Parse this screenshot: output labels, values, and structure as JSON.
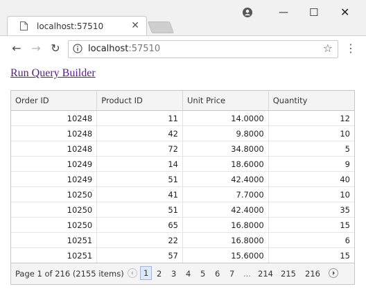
{
  "browser": {
    "tab_title": "localhost:57510",
    "url_host": "localhost",
    "url_port": ":57510"
  },
  "page": {
    "link_text": "Run Query Builder"
  },
  "grid": {
    "columns": [
      "Order ID",
      "Product ID",
      "Unit Price",
      "Quantity"
    ],
    "rows": [
      [
        "10248",
        "11",
        "14.0000",
        "12"
      ],
      [
        "10248",
        "42",
        "9.8000",
        "10"
      ],
      [
        "10248",
        "72",
        "34.8000",
        "5"
      ],
      [
        "10249",
        "14",
        "18.6000",
        "9"
      ],
      [
        "10249",
        "51",
        "42.4000",
        "40"
      ],
      [
        "10250",
        "41",
        "7.7000",
        "10"
      ],
      [
        "10250",
        "51",
        "42.4000",
        "35"
      ],
      [
        "10250",
        "65",
        "16.8000",
        "15"
      ],
      [
        "10251",
        "22",
        "16.8000",
        "6"
      ],
      [
        "10251",
        "57",
        "15.6000",
        "15"
      ]
    ],
    "pager": {
      "summary": "Page 1 of 216 (2155 items)",
      "pages": [
        "1",
        "2",
        "3",
        "4",
        "5",
        "6",
        "7",
        "...",
        "214",
        "215",
        "216"
      ],
      "current": "1"
    }
  }
}
